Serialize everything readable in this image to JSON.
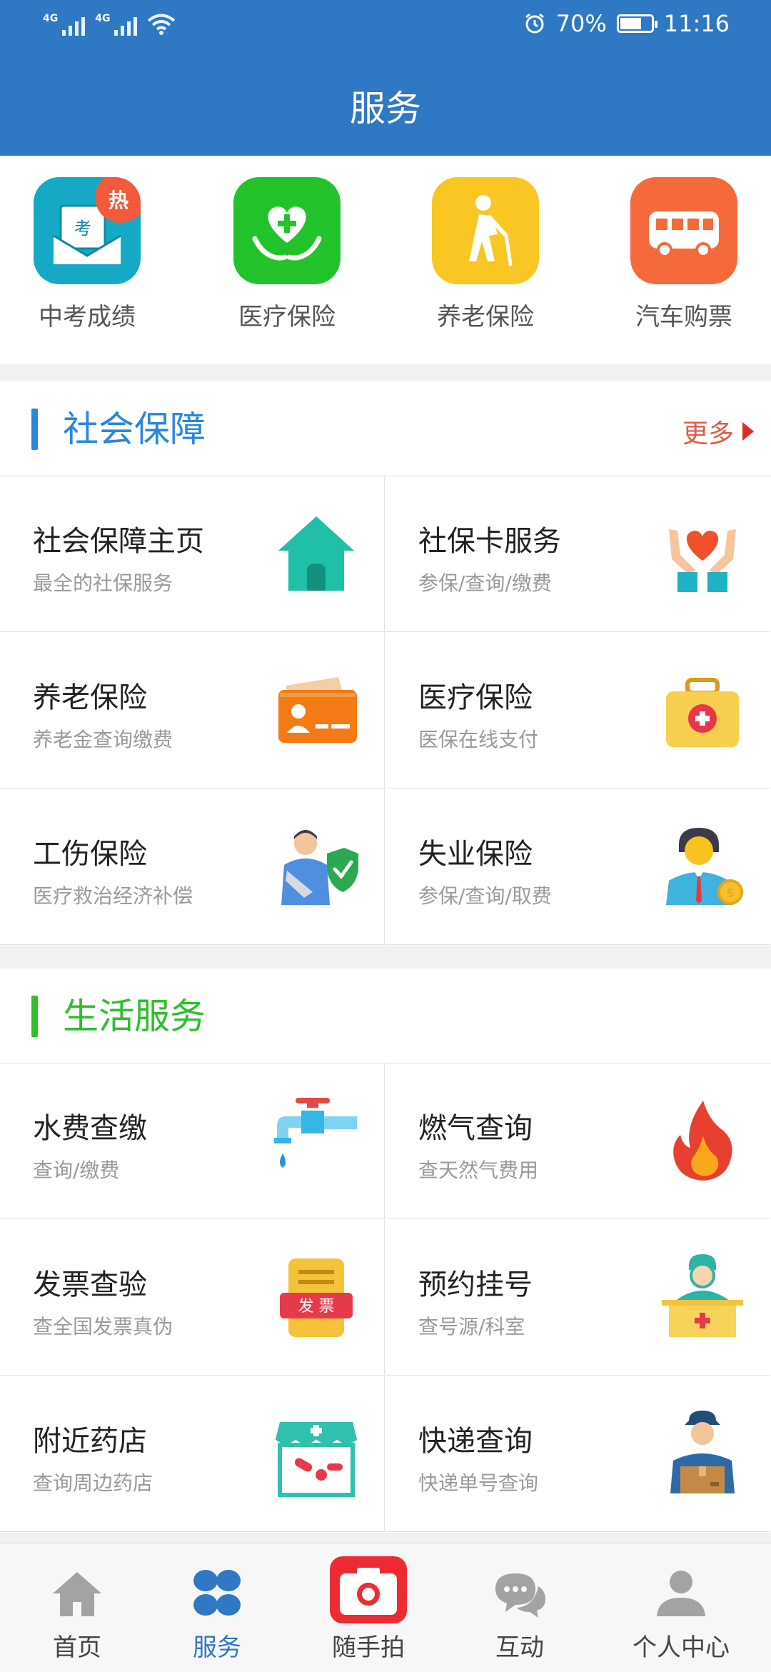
{
  "status_bar": {
    "net1": "4G",
    "net2": "4G",
    "battery": "70%",
    "battery_level": 0.7,
    "time": "11:16"
  },
  "header": {
    "title": "服务"
  },
  "quick_links": [
    {
      "label": "中考成绩",
      "badge": "热",
      "icon_text": "考",
      "icon": "exam-icon",
      "color": "#15a9c5"
    },
    {
      "label": "医疗保险",
      "icon": "medical-heart-icon",
      "color": "#22c32a"
    },
    {
      "label": "养老保险",
      "icon": "elderly-icon",
      "color": "#f9c623"
    },
    {
      "label": "汽车购票",
      "icon": "bus-icon",
      "color": "#f6693a"
    }
  ],
  "social": {
    "title": "社会保障",
    "more": "更多",
    "color": "#2a87dc",
    "items": [
      {
        "title": "社会保障主页",
        "subtitle": "最全的社保服务",
        "icon": "home-icon"
      },
      {
        "title": "社保卡服务",
        "subtitle": "参保/查询/缴费",
        "icon": "hands-heart-icon"
      },
      {
        "title": "养老保险",
        "subtitle": "养老金查询缴费",
        "icon": "id-card-icon"
      },
      {
        "title": "医疗保险",
        "subtitle": "医保在线支付",
        "icon": "medical-kit-icon"
      },
      {
        "title": "工伤保险",
        "subtitle": "医疗救治经济补偿",
        "icon": "injured-shield-icon"
      },
      {
        "title": "失业保险",
        "subtitle": "参保/查询/取费",
        "icon": "businessman-coin-icon"
      }
    ]
  },
  "life": {
    "title": "生活服务",
    "color": "#2fbf2a",
    "items": [
      {
        "title": "水费查缴",
        "subtitle": "查询/缴费",
        "icon": "faucet-icon"
      },
      {
        "title": "燃气查询",
        "subtitle": "查天然气费用",
        "icon": "flame-icon"
      },
      {
        "title": "发票查验",
        "subtitle": "查全国发票真伪",
        "icon": "invoice-icon",
        "icon_text": "发 票"
      },
      {
        "title": "预约挂号",
        "subtitle": "查号源/科室",
        "icon": "doctor-icon"
      },
      {
        "title": "附近药店",
        "subtitle": "查询周边药店",
        "icon": "pharmacy-icon"
      },
      {
        "title": "快递查询",
        "subtitle": "快递单号查询",
        "icon": "courier-icon"
      }
    ]
  },
  "bottom_nav": [
    {
      "label": "首页",
      "icon": "home-icon"
    },
    {
      "label": "服务",
      "icon": "services-grid-icon",
      "active": true
    },
    {
      "label": "随手拍",
      "icon": "camera-icon"
    },
    {
      "label": "互动",
      "icon": "chat-icon"
    },
    {
      "label": "个人中心",
      "icon": "person-icon"
    }
  ]
}
